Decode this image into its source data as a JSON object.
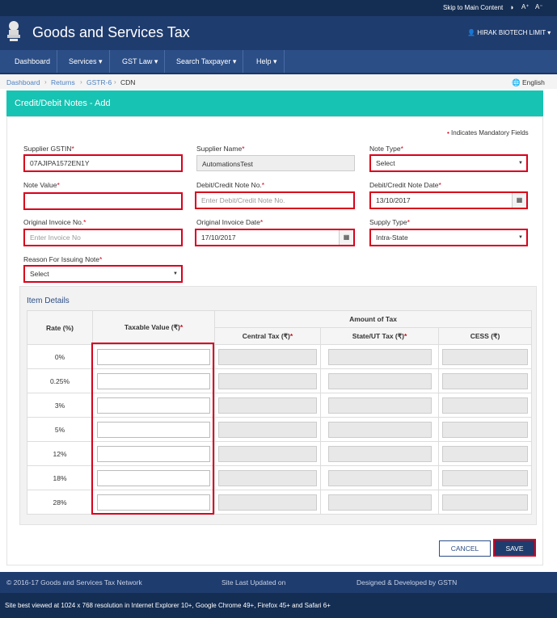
{
  "topbar": {
    "skip": "Skip to Main Content",
    "a_plus": "A⁺",
    "a_minus": "A⁻"
  },
  "header": {
    "title": "Goods and Services Tax",
    "user": "HIRAK BIOTECH LIMIT"
  },
  "nav": [
    "Dashboard",
    "Services",
    "GST Law",
    "Search Taxpayer",
    "Help"
  ],
  "breadcrumb": [
    "Dashboard",
    "Returns",
    "GSTR-6",
    "CDN"
  ],
  "language": "English",
  "page_title": "Credit/Debit Notes - Add",
  "mandatory_note": "Indicates Mandatory Fields",
  "form": {
    "supplier_gstin": {
      "label": "Supplier GSTIN",
      "value": "07AJIPA1572EN1Y"
    },
    "supplier_name": {
      "label": "Supplier Name",
      "value": "AutomationsTest"
    },
    "note_type": {
      "label": "Note Type",
      "value": "Select"
    },
    "note_value": {
      "label": "Note Value",
      "value": ""
    },
    "note_no": {
      "label": "Debit/Credit Note No.",
      "placeholder": "Enter Debit/Credit Note No."
    },
    "note_date": {
      "label": "Debit/Credit Note Date",
      "value": "13/10/2017"
    },
    "invoice_no": {
      "label": "Original Invoice No.",
      "placeholder": "Enter Invoice No"
    },
    "invoice_date": {
      "label": "Original Invoice Date",
      "value": "17/10/2017"
    },
    "supply_type": {
      "label": "Supply Type",
      "value": "Intra-State"
    },
    "reason": {
      "label": "Reason For Issuing Note",
      "value": "Select"
    }
  },
  "items": {
    "title": "Item Details",
    "headers": {
      "rate": "Rate (%)",
      "taxable": "Taxable Value (₹)",
      "amount": "Amount of Tax",
      "central": "Central Tax (₹)",
      "state": "State/UT Tax (₹)",
      "cess": "CESS (₹)"
    },
    "rates": [
      "0%",
      "0.25%",
      "3%",
      "5%",
      "12%",
      "18%",
      "28%"
    ]
  },
  "buttons": {
    "cancel": "CANCEL",
    "save": "SAVE"
  },
  "footer": {
    "copyright": "© 2016-17 Goods and Services Tax Network",
    "updated": "Site Last Updated on",
    "designed": "Designed & Developed by GSTN",
    "browser_note": "Site best viewed at 1024 x 768 resolution in Internet Explorer 10+, Google Chrome 49+, Firefox 45+ and Safari 6+"
  }
}
